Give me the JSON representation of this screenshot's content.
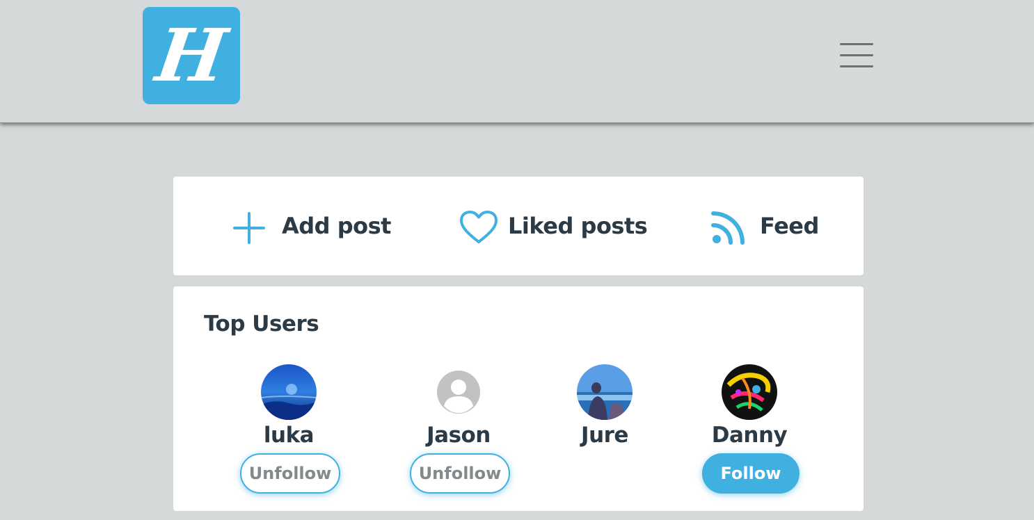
{
  "header": {
    "logo_letter": "H",
    "menu_icon": "hamburger-menu-icon"
  },
  "actions": [
    {
      "label": "Add post",
      "icon": "plus-icon"
    },
    {
      "label": "Liked posts",
      "icon": "heart-icon"
    },
    {
      "label": "Feed",
      "icon": "rss-feed-icon"
    }
  ],
  "top_users": {
    "title": "Top Users",
    "users": [
      {
        "name": "luka",
        "button": "Unfollow"
      },
      {
        "name": "Jason",
        "button": "Unfollow"
      },
      {
        "name": "Jure"
      },
      {
        "name": "Danny",
        "button": "Follow"
      }
    ]
  },
  "colors": {
    "accent": "#3fb0e0",
    "background": "#d5d9d9",
    "text": "#2b3a45"
  }
}
